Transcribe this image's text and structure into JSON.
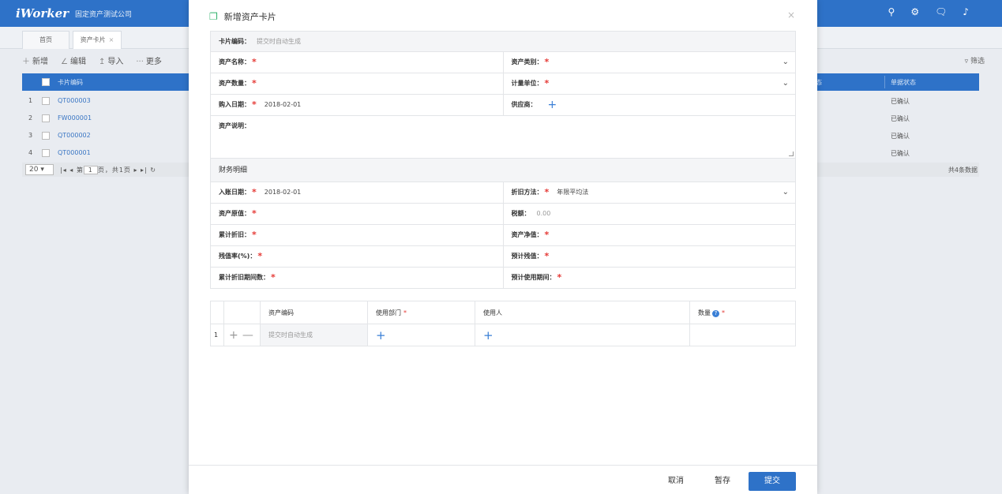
{
  "app": {
    "logo": "iWorker",
    "company": "固定资产测试公司",
    "top_icons": [
      "search-icon",
      "settings-icon",
      "message-icon",
      "bell-icon"
    ]
  },
  "tabs": [
    {
      "label": "首页"
    },
    {
      "label": "资产卡片",
      "close": "×"
    }
  ],
  "toolbar": {
    "add": "新增",
    "edit": "编辑",
    "import": "导入",
    "more": "更多",
    "filter": "筛选"
  },
  "grid": {
    "col_code": "卡片编码",
    "col_status_partial": "态",
    "col_doc_status": "单据状态",
    "rows": [
      {
        "idx": "1",
        "code": "QT000003",
        "status": "已确认"
      },
      {
        "idx": "2",
        "code": "FW000001",
        "status": "已确认"
      },
      {
        "idx": "3",
        "code": "QT000002",
        "status": "已确认"
      },
      {
        "idx": "4",
        "code": "QT000001",
        "status": "已确认"
      }
    ]
  },
  "pager": {
    "page_size": "20",
    "page_prefix": "第",
    "page_value": "1",
    "page_suffix": "页，共1页",
    "total": "共4条数据"
  },
  "modal": {
    "title": "新增资产卡片",
    "close": "×",
    "card_code_label": "卡片编码：",
    "card_code_hint": "提交时自动生成",
    "asset_name": "资产名称：",
    "asset_category": "资产类别：",
    "asset_quantity": "资产数量：",
    "unit": "计量单位：",
    "purchase_date_label": "购入日期：",
    "purchase_date_value": "2018-02-01",
    "supplier": "供应商：",
    "asset_desc": "资产说明：",
    "finance_section": "财务明细",
    "entry_date_label": "入账日期：",
    "entry_date_value": "2018-02-01",
    "depr_method_label": "折旧方法：",
    "depr_method_value": "年限平均法",
    "original_value": "资产原值：",
    "tax_label": "税额：",
    "tax_value": "0.00",
    "accum_depr": "累计折旧：",
    "net_value": "资产净值：",
    "salvage_rate": "残值率(%)：",
    "est_salvage": "预计残值：",
    "accum_depr_periods": "累计折旧期间数：",
    "est_use_periods": "预计使用期间："
  },
  "detail_table": {
    "headers": {
      "asset_code": "资产编码",
      "dept": "使用部门",
      "user": "使用人",
      "qty": "数量"
    },
    "row": {
      "idx": "1",
      "asset_code_hint": "提交时自动生成"
    }
  },
  "footer": {
    "cancel": "取消",
    "draft": "暂存",
    "submit": "提交"
  },
  "colors": {
    "brand": "#2e72c8",
    "required": "#e53935",
    "link": "#3a7fd6"
  }
}
